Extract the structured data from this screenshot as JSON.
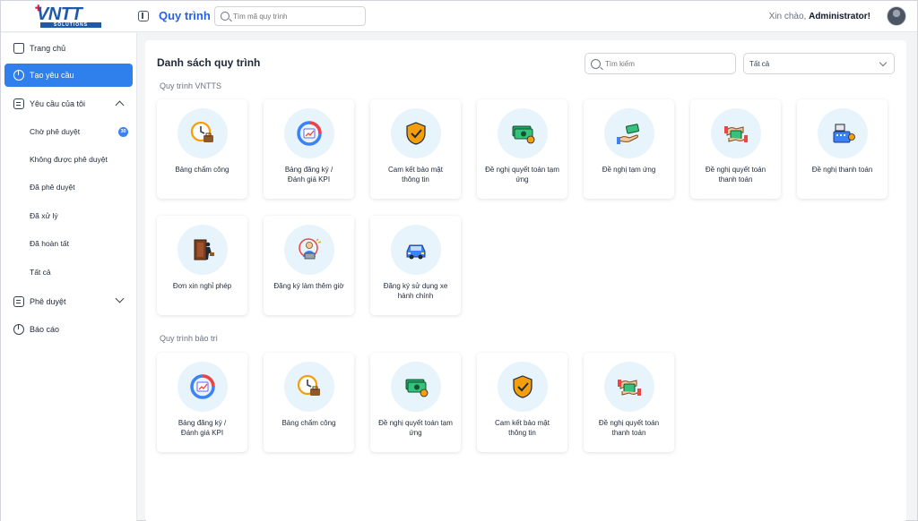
{
  "header": {
    "logo_text": "VNTT",
    "logo_sub": "SOLUTIONS",
    "title": "Quy trình",
    "search_placeholder": "Tìm mã quy trình",
    "greeting": "Xin chào,",
    "user": "Administrator!"
  },
  "sidebar": {
    "home": "Trang chủ",
    "create": "Tạo yêu cầu",
    "my_requests": "Yêu cầu của tôi",
    "sub": [
      "Chờ phê duyệt",
      "Không được phê duyệt",
      "Đã phê duyệt",
      "Đã xử lý",
      "Đã hoàn tất",
      "Tất cả"
    ],
    "pending_count": "30",
    "approval": "Phê duyệt",
    "report": "Báo cáo"
  },
  "main": {
    "heading": "Danh sách quy trình",
    "search_placeholder": "Tìm kiếm",
    "filter_value": "Tất cả",
    "group1": "Quy trình VNTTS",
    "group2": "Quy trình bảo trì",
    "cards1": [
      {
        "label": "Bảng chấm công",
        "icon": "clock-briefcase-icon"
      },
      {
        "label": "Bảng đăng ký /\nĐánh giá KPI",
        "icon": "kpi-chart-icon"
      },
      {
        "label": "Cam kết bảo mật\nthông tin",
        "icon": "security-shield-icon"
      },
      {
        "label": "Đề nghị quyết toán tạm\nứng",
        "icon": "money-bills-icon"
      },
      {
        "label": "Đề nghị tạm ứng",
        "icon": "hand-money-icon"
      },
      {
        "label": "Đề nghị quyết toán\nthanh toán",
        "icon": "money-exchange-icon"
      },
      {
        "label": "Đề nghị thanh toán",
        "icon": "cash-register-icon"
      },
      {
        "label": "Đơn xin nghỉ phép",
        "icon": "door-exit-icon"
      },
      {
        "label": "Đăng ký làm thêm giờ",
        "icon": "overtime-worker-icon"
      },
      {
        "label": "Đăng ký sử dụng xe\nhành chính",
        "icon": "car-icon"
      }
    ],
    "cards2": [
      {
        "label": "Bảng đăng ký /\nĐánh giá KPI",
        "icon": "kpi-chart-icon"
      },
      {
        "label": "Bảng chấm công",
        "icon": "clock-briefcase-icon"
      },
      {
        "label": "Đề nghị quyết toán tạm\nứng",
        "icon": "money-bills-icon"
      },
      {
        "label": "Cam kết bảo mật\nthông tin",
        "icon": "security-shield-icon"
      },
      {
        "label": "Đề nghị quyết toán\nthanh toán",
        "icon": "money-exchange-icon"
      }
    ]
  }
}
